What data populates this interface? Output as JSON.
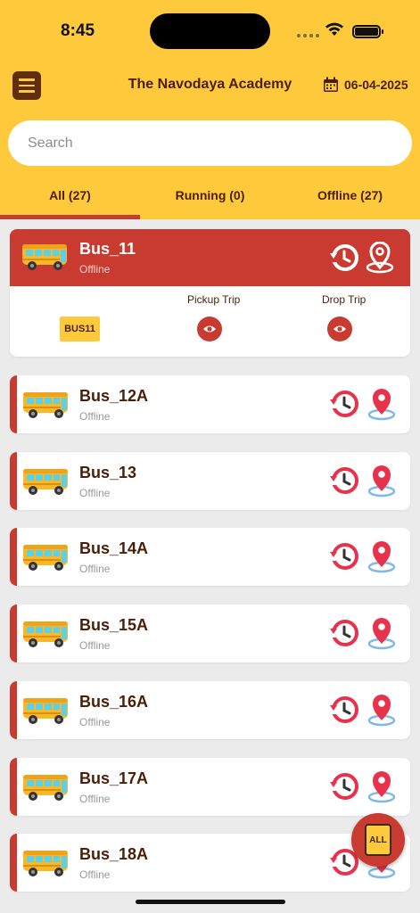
{
  "status_bar": {
    "time": "8:45"
  },
  "header": {
    "title": "The Navodaya Academy",
    "date": "06-04-2025"
  },
  "search": {
    "placeholder": "Search"
  },
  "tabs": [
    {
      "label": "All (27)",
      "active": true
    },
    {
      "label": "Running (0)",
      "active": false
    },
    {
      "label": "Offline (27)",
      "active": false
    }
  ],
  "expanded_bus": {
    "name": "Bus_11",
    "status": "Offline",
    "plate": "BUS11",
    "pickup_label": "Pickup Trip",
    "drop_label": "Drop Trip"
  },
  "buses": [
    {
      "name": "Bus_12A",
      "status": "Offline"
    },
    {
      "name": "Bus_13",
      "status": "Offline"
    },
    {
      "name": "Bus_14A",
      "status": "Offline"
    },
    {
      "name": "Bus_15A",
      "status": "Offline"
    },
    {
      "name": "Bus_16A",
      "status": "Offline"
    },
    {
      "name": "Bus_17A",
      "status": "Offline"
    },
    {
      "name": "Bus_18A",
      "status": "Offline"
    }
  ],
  "fab": {
    "label": "ALL"
  },
  "colors": {
    "brand_yellow": "#fec93a",
    "brand_red": "#c93b31",
    "brand_brown": "#4a1f08"
  }
}
